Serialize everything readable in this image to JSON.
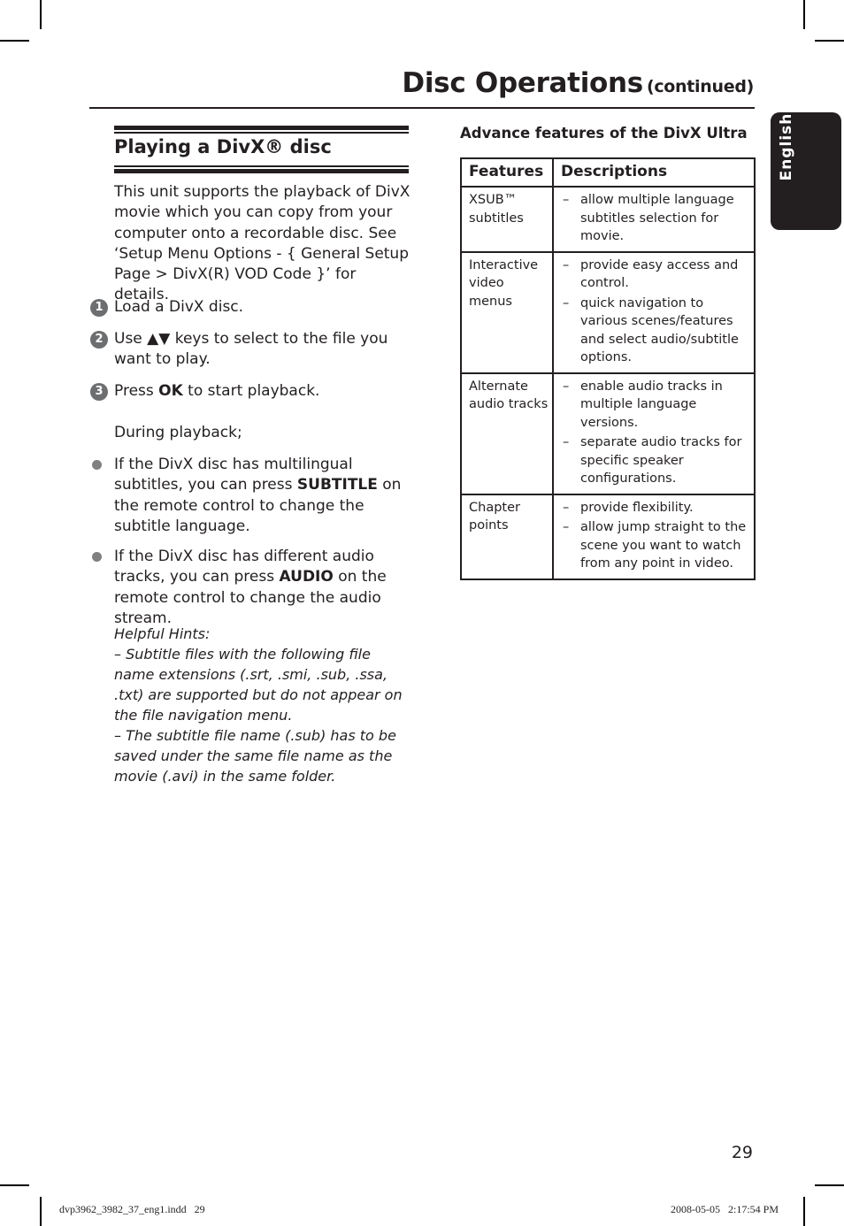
{
  "header": {
    "title": "Disc Operations",
    "title_suffix": "(continued)"
  },
  "language_tab": "English",
  "left_section": {
    "title": "Playing a DivX® disc",
    "intro": "This unit supports the playback of DivX movie which you can copy from your computer onto a recordable disc. See ‘Setup Menu Options - { General Setup Page > DivX(R) VOD Code }’ for details.",
    "steps": [
      {
        "number": "1",
        "text_before": "Load a DivX disc.",
        "bold": "",
        "text_after": ""
      },
      {
        "number": "2",
        "text_before": "Use ▲▼ keys to select to the file you want to play.",
        "bold": "",
        "text_after": ""
      },
      {
        "number": "3",
        "text_before": "Press ",
        "bold": "OK",
        "text_after": " to start playback."
      }
    ],
    "during_playback": "During playback;",
    "bullets": [
      {
        "text_before": "If the DivX disc has multilingual subtitles, you can press ",
        "bold": "SUBTITLE",
        "text_after": " on the remote control to change the subtitle language."
      },
      {
        "text_before": "If the DivX disc has different audio tracks, you can press ",
        "bold": "AUDIO",
        "text_after": " on the remote control to change the audio stream."
      }
    ],
    "hints": {
      "title": "Helpful Hints:",
      "items": [
        "–  Subtitle files with the following file name extensions (.srt, .smi, .sub, .ssa, .txt) are supported but do not appear on the file navigation menu.",
        "–  The subtitle file name (.sub) has to be saved under the same file name as the movie (.avi) in the same folder."
      ]
    }
  },
  "right_section": {
    "heading": "Advance features of the DivX Ultra",
    "table": {
      "headers": [
        "Features",
        "Descriptions"
      ],
      "rows": [
        {
          "feature": "XSUB™ subtitles",
          "descriptions": [
            "allow multiple language subtitles selection for movie."
          ]
        },
        {
          "feature": "Interactive video menus",
          "descriptions": [
            "provide easy access and control.",
            "quick navigation to various scenes/features and select audio/subtitle options."
          ]
        },
        {
          "feature": "Alternate audio tracks",
          "descriptions": [
            "enable audio tracks in multiple language versions.",
            "separate audio tracks for specific speaker configurations."
          ]
        },
        {
          "feature": "Chapter points",
          "descriptions": [
            "provide flexibility.",
            "allow jump straight to the scene you want to watch from any point in video."
          ]
        }
      ]
    }
  },
  "footer": {
    "page_number": "29",
    "slug_file": "dvp3962_3982_37_eng1.indd   29",
    "slug_timestamp": "2008-05-05   2:17:54 PM"
  }
}
